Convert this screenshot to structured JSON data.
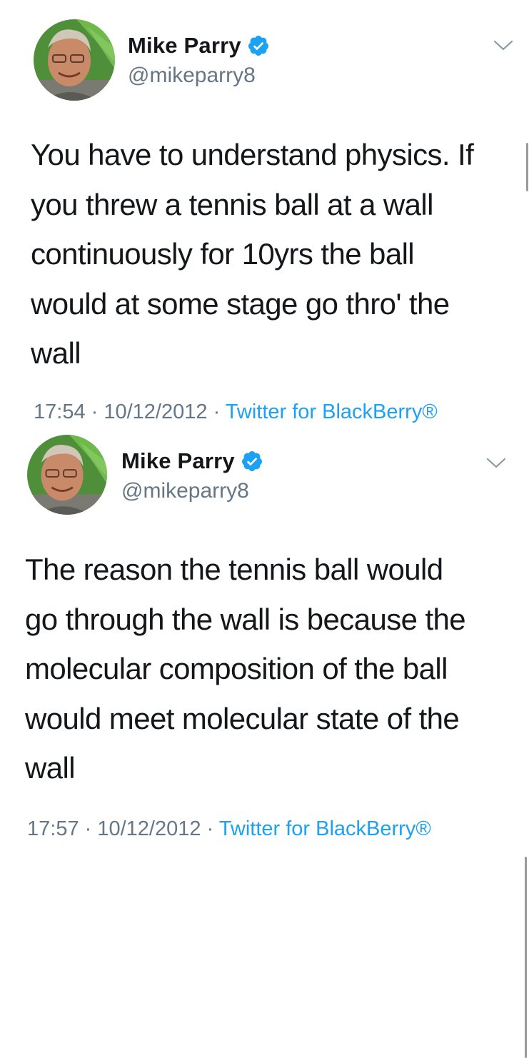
{
  "tweets": [
    {
      "author": {
        "name": "Mike Parry",
        "handle": "@mikeparry8",
        "verified": true
      },
      "text": "You have to understand physics. If\nyou threw a tennis ball at a wall\ncontinuously for 10yrs the ball\nwould at some stage go thro' the\nwall",
      "time": "17:54",
      "date": "10/12/2012",
      "source": "Twitter for BlackBerry®"
    },
    {
      "author": {
        "name": "Mike Parry",
        "handle": "@mikeparry8",
        "verified": true
      },
      "text": "The reason the tennis ball would\ngo through the wall is because the\nmolecular composition of the ball\nwould meet molecular state of the\nwall",
      "time": "17:57",
      "date": "10/12/2012",
      "source": "Twitter for BlackBerry®"
    }
  ],
  "meta": {
    "separator": " · "
  },
  "colors": {
    "accent": "#1da1f2",
    "secondary_text": "#657786",
    "primary_text": "#14171a"
  },
  "icons": {
    "verified": "verified-badge-icon",
    "more": "chevron-down-icon"
  }
}
